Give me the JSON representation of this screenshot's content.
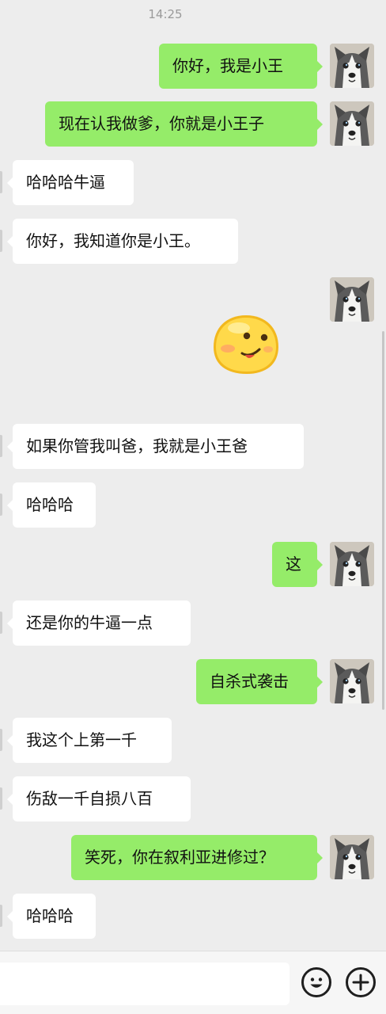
{
  "status": {
    "time": "14:25"
  },
  "messages": [
    {
      "side": "out",
      "text": "你好，我是小王"
    },
    {
      "side": "out",
      "text": "现在认我做爹，你就是小王子"
    },
    {
      "side": "in",
      "text": "哈哈哈牛逼"
    },
    {
      "side": "in",
      "text": "你好，我知道你是小王。"
    },
    {
      "side": "out",
      "type": "sticker",
      "icon": "smirk-emoji-sticker"
    },
    {
      "side": "in",
      "text": "如果你管我叫爸，我就是小王爸"
    },
    {
      "side": "in",
      "text": "哈哈哈"
    },
    {
      "side": "out",
      "text": "这"
    },
    {
      "side": "in",
      "text": "还是你的牛逼一点"
    },
    {
      "side": "out",
      "text": "自杀式袭击"
    },
    {
      "side": "in",
      "text": "我这个上第一千"
    },
    {
      "side": "in",
      "text": "伤敌一千自损八百"
    },
    {
      "side": "out",
      "text": "笑死，你在叙利亚进修过？"
    },
    {
      "side": "in",
      "text": "哈哈哈"
    }
  ],
  "input": {
    "value": "",
    "placeholder": ""
  },
  "toolbar": {
    "emoji_icon": "smiley-face-icon",
    "plus_icon": "plus-icon"
  },
  "colors": {
    "background": "#ededed",
    "outgoing_bubble": "#95ec69",
    "incoming_bubble": "#ffffff",
    "timestamp": "#9a9a9a"
  }
}
